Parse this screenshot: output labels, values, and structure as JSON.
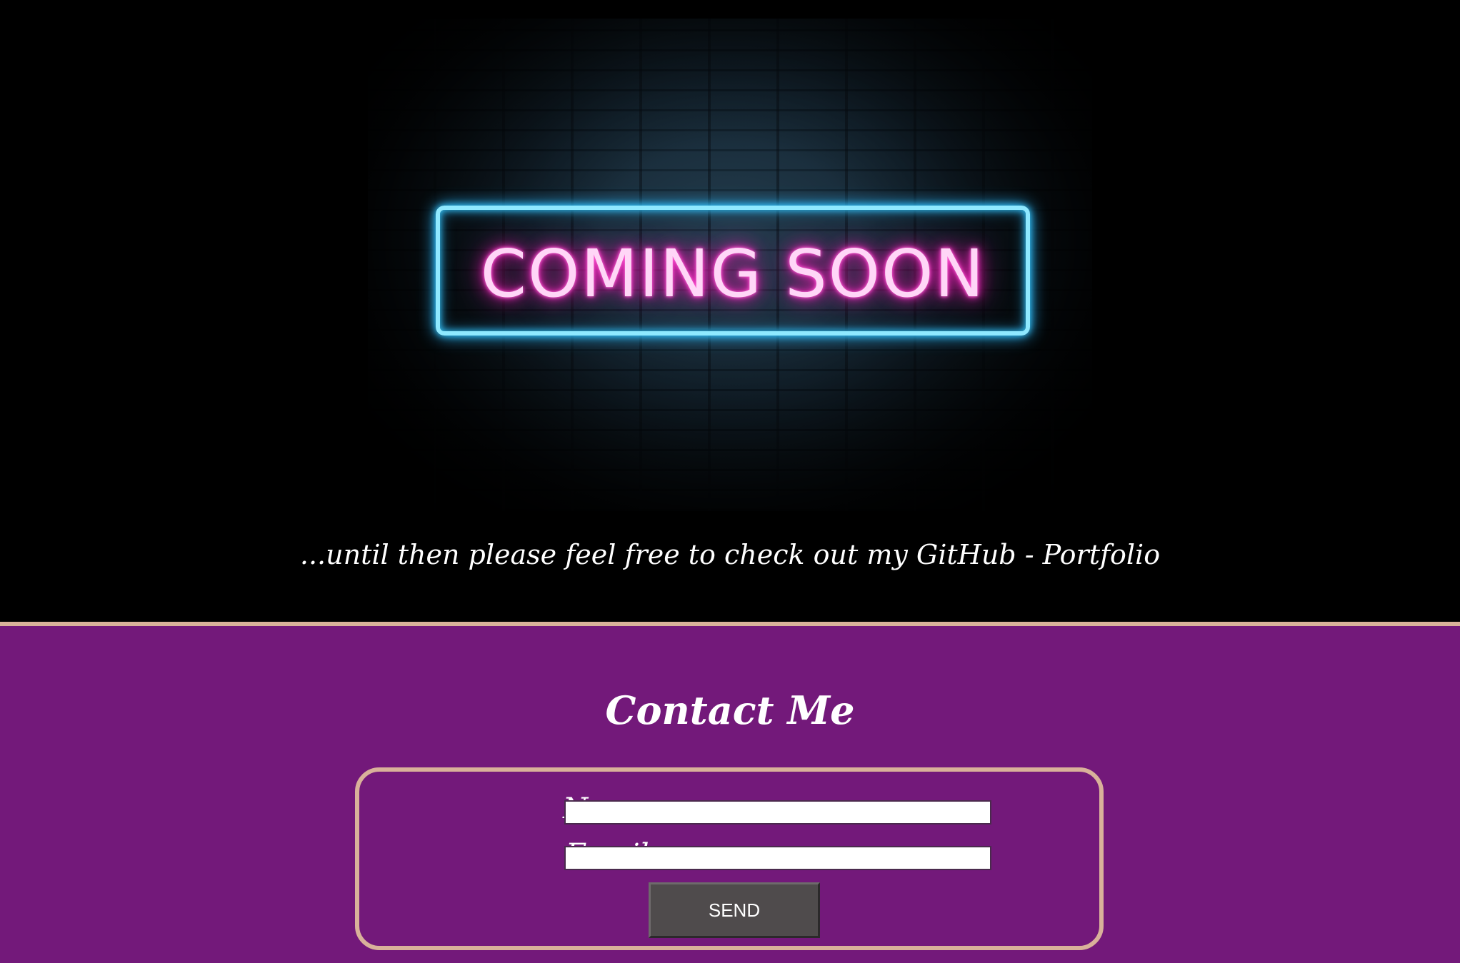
{
  "hero": {
    "image_text": "COMING SOON",
    "tagline": "...until then please feel free to check out my GitHub - Portfolio"
  },
  "contact": {
    "title": "Contact Me",
    "name_label": "Name:",
    "email_label": "Email:",
    "name_value": "",
    "email_value": "",
    "send_label": "SEND"
  },
  "colors": {
    "hero_background": "#000000",
    "contact_background": "#73197a",
    "accent_border": "#d9b19a",
    "neon_frame": "#8fe9ff",
    "neon_text": "#ff2fc8",
    "button_background": "#4f4b4c"
  }
}
